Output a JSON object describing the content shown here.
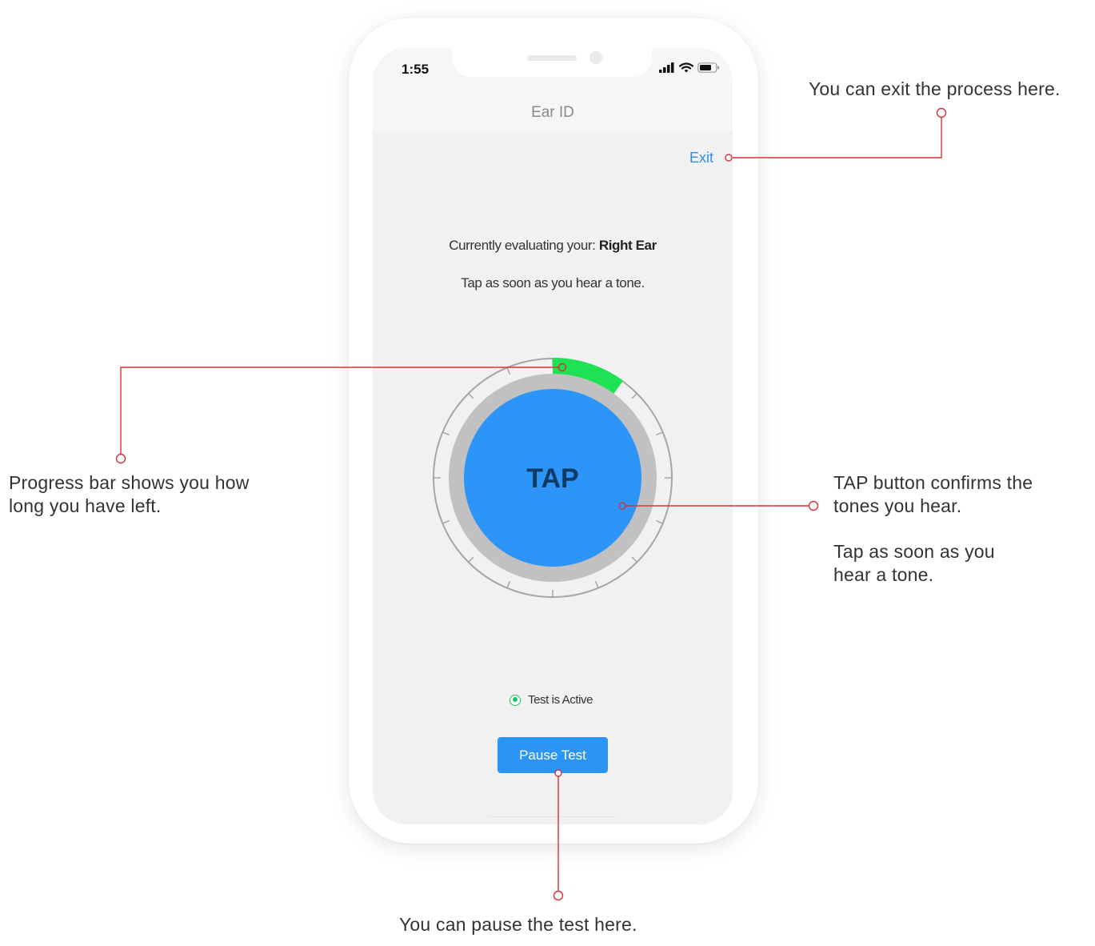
{
  "status_bar": {
    "time": "1:55",
    "icons": [
      "signal-icon",
      "wifi-icon",
      "battery-icon"
    ]
  },
  "app": {
    "title": "Ear ID",
    "exit_label": "Exit"
  },
  "test": {
    "evaluating_prefix": "Currently evaluating your:",
    "evaluating_ear": "Right Ear",
    "instruction": "Tap as soon as you hear a tone.",
    "tap_label": "TAP",
    "progress_fraction": 0.1,
    "status_text": "Test is Active",
    "pause_label": "Pause Test"
  },
  "annotations": {
    "exit": "You can exit the process here.",
    "progress": [
      "Progress bar shows you how",
      "long you have left."
    ],
    "tap": [
      "TAP button confirms the",
      "tones you hear."
    ],
    "tap_hint": [
      "Tap as soon as you",
      "hear a tone."
    ],
    "pause": "You can pause the test here."
  },
  "colors": {
    "accent_blue": "#2b94f5",
    "progress_green": "#1ee253",
    "callout_red": "#d9303a",
    "active_green": "#1cc45e"
  }
}
